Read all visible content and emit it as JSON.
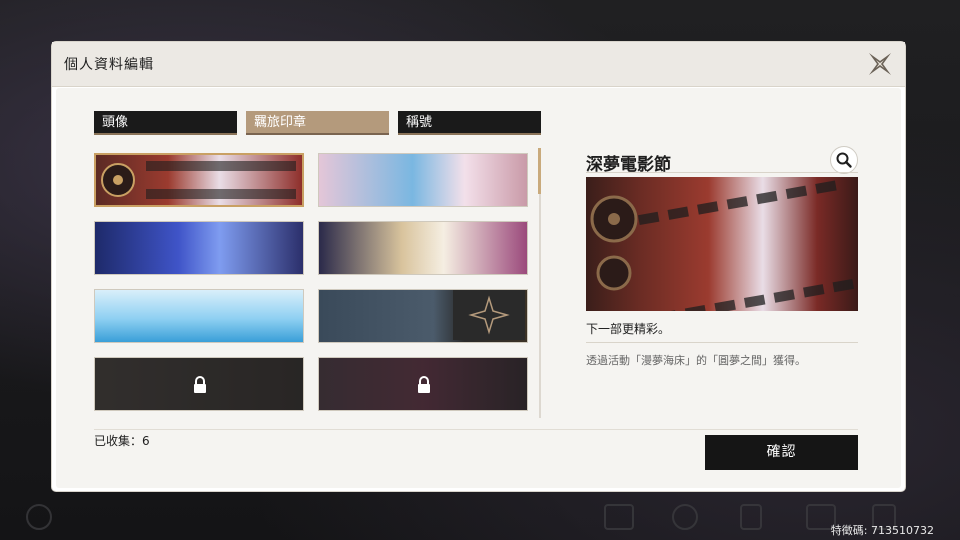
{
  "dialog": {
    "title": "個人資料編輯"
  },
  "tabs": [
    {
      "label": "頭像",
      "active": false
    },
    {
      "label": "羈旅印章",
      "active": true
    },
    {
      "label": "稱號",
      "active": false
    }
  ],
  "cards": [
    {
      "id": "card-0",
      "state": "selected"
    },
    {
      "id": "card-1",
      "state": "unlocked"
    },
    {
      "id": "card-2",
      "state": "unlocked"
    },
    {
      "id": "card-3",
      "state": "unlocked"
    },
    {
      "id": "card-4",
      "state": "unlocked"
    },
    {
      "id": "card-5",
      "state": "unlocked"
    },
    {
      "id": "card-6",
      "state": "locked"
    },
    {
      "id": "card-7",
      "state": "locked"
    }
  ],
  "collected": {
    "text": "已收集：6"
  },
  "detail": {
    "title": "深夢電影節",
    "subtitle": "下一部更精彩。",
    "description": "透過活動「漫夢海床」的「圓夢之間」獲得。"
  },
  "confirm_label": "確認",
  "footer": {
    "uid": "特徵碼: 713510732"
  },
  "colors": {
    "accent": "#b49a7c",
    "selected_border": "#c9a063",
    "dark": "#151515"
  }
}
